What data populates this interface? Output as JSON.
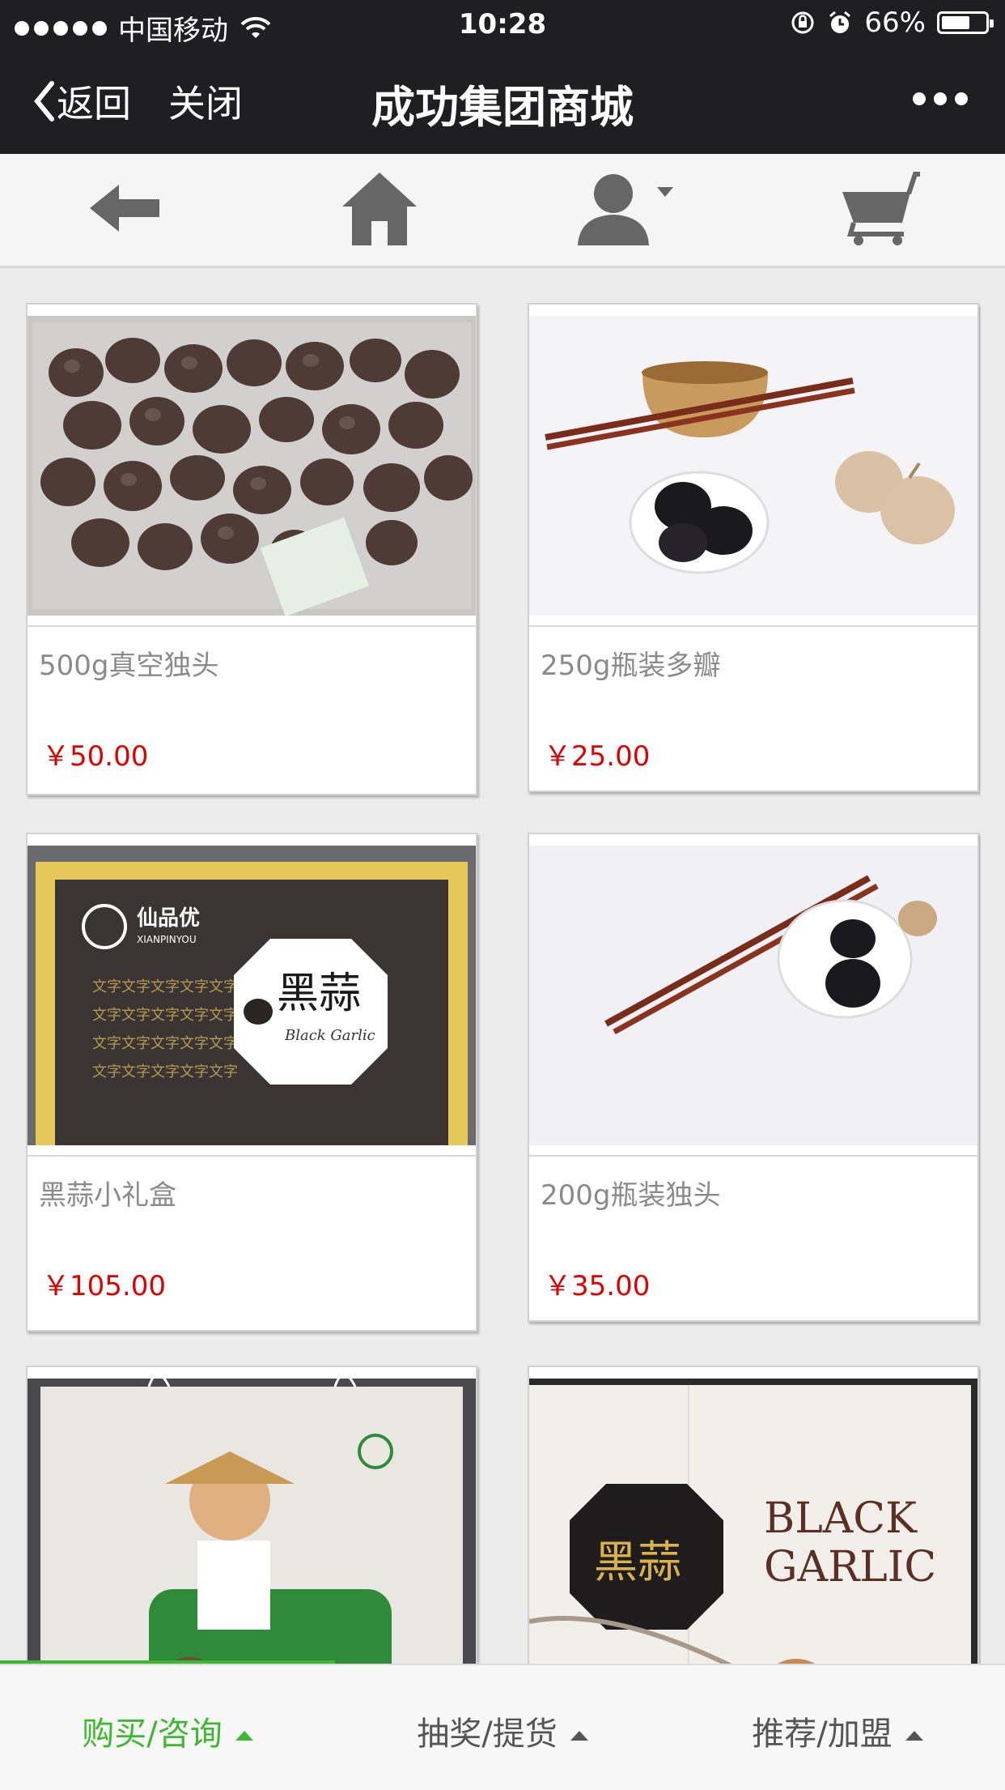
{
  "status_bar": {
    "carrier": "中国移动",
    "time": "10:28",
    "battery": "66%",
    "battery_level": 0.66
  },
  "nav": {
    "back_label": "返回",
    "close_label": "关闭",
    "title": "成功集团商城"
  },
  "toolbar": {
    "icons": [
      "back-arrow-icon",
      "home-icon",
      "user-icon",
      "cart-icon"
    ]
  },
  "products": [
    {
      "name": "500g真空独头",
      "price": "￥50.00"
    },
    {
      "name": "250g瓶装多瓣",
      "price": "￥25.00"
    },
    {
      "name": "黑蒜小礼盒",
      "price": "￥105.00"
    },
    {
      "name": "200g瓶装独头",
      "price": "￥35.00"
    },
    {
      "name": "",
      "price": ""
    },
    {
      "name": "",
      "price": ""
    }
  ],
  "product_image_text": {
    "box_brand": "仙品优",
    "box_brand_en": "XIANPINYOU",
    "box_title": "黑蒜",
    "box_title_en": "Black Garlic",
    "bag_label": "黑蒜",
    "gift_box_cn": "黑蒜",
    "gift_box_en_line1": "BLACK",
    "gift_box_en_line2": "GARLIC"
  },
  "bottom_menu": [
    {
      "label": "购买/咨询",
      "active": true
    },
    {
      "label": "抽奖/提货",
      "active": false
    },
    {
      "label": "推荐/加盟",
      "active": false
    }
  ],
  "colors": {
    "header_bg": "#1f1f21",
    "active_green": "#3db82f",
    "price_red": "#e00000"
  }
}
